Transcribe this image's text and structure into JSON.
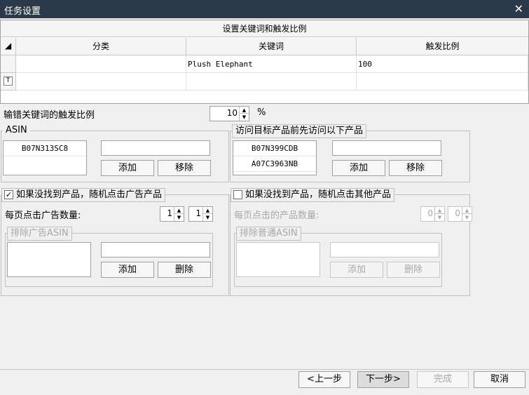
{
  "window": {
    "title": "任务设置",
    "close_glyph": "✕"
  },
  "keyword_grid": {
    "caption": "设置关键词和触发比例",
    "corner_glyph": "◢",
    "columns": [
      "分类",
      "关键词",
      "触发比例"
    ],
    "rows": [
      {
        "category": "",
        "keyword": "Plush Elephant",
        "ratio": "100"
      }
    ],
    "new_row_icon_glyph": "T"
  },
  "typo_ratio": {
    "label": "输错关键词的触发比例",
    "value": "10",
    "unit": "%"
  },
  "asin_group": {
    "title": "ASIN",
    "items": [
      "B07N313SC8"
    ],
    "input_value": "",
    "add_label": "添加",
    "remove_label": "移除"
  },
  "visit_group": {
    "title": "访问目标产品前先访问以下产品",
    "items": [
      "B07N399CDB",
      "A07C3963NB"
    ],
    "input_value": "",
    "add_label": "添加",
    "remove_label": "移除"
  },
  "ad_group": {
    "checked": true,
    "check_glyph": "✓",
    "title": "如果没找到产品，随机点击广告产品",
    "per_page_label": "每页点击广告数量:",
    "spin1": "1",
    "spin2": "1",
    "exclude": {
      "title": "排除广告ASIN",
      "input_value": "",
      "add_label": "添加",
      "delete_label": "删除"
    }
  },
  "other_group": {
    "checked": false,
    "title": "如果没找到产品，随机点击其他产品",
    "per_page_label": "每页点击的产品数量:",
    "spin1": "0",
    "spin2": "0",
    "exclude": {
      "title": "排除普通ASIN",
      "input_value": "",
      "add_label": "添加",
      "delete_label": "删除"
    }
  },
  "footer": {
    "prev_label": "<上一步",
    "next_label": "下一步>",
    "finish_label": "完成",
    "cancel_label": "取消"
  },
  "spin_glyphs": {
    "up": "▲",
    "down": "▼"
  }
}
